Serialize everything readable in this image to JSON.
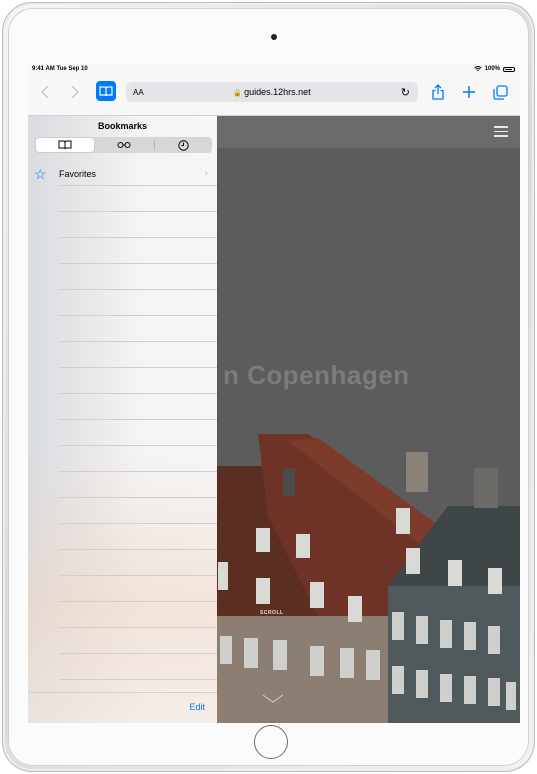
{
  "status_bar": {
    "time": "9:41 AM  Tue Sep 10",
    "battery": "100%"
  },
  "toolbar": {
    "url": "guides.12hrs.net",
    "text_size_label": "AA"
  },
  "sidebar": {
    "title": "Bookmarks",
    "favorites_label": "Favorites",
    "edit_label": "Edit"
  },
  "web": {
    "hero_title": "n Copenhagen",
    "scroll_label": "SCROLL"
  },
  "colors": {
    "accent": "#007aff"
  }
}
